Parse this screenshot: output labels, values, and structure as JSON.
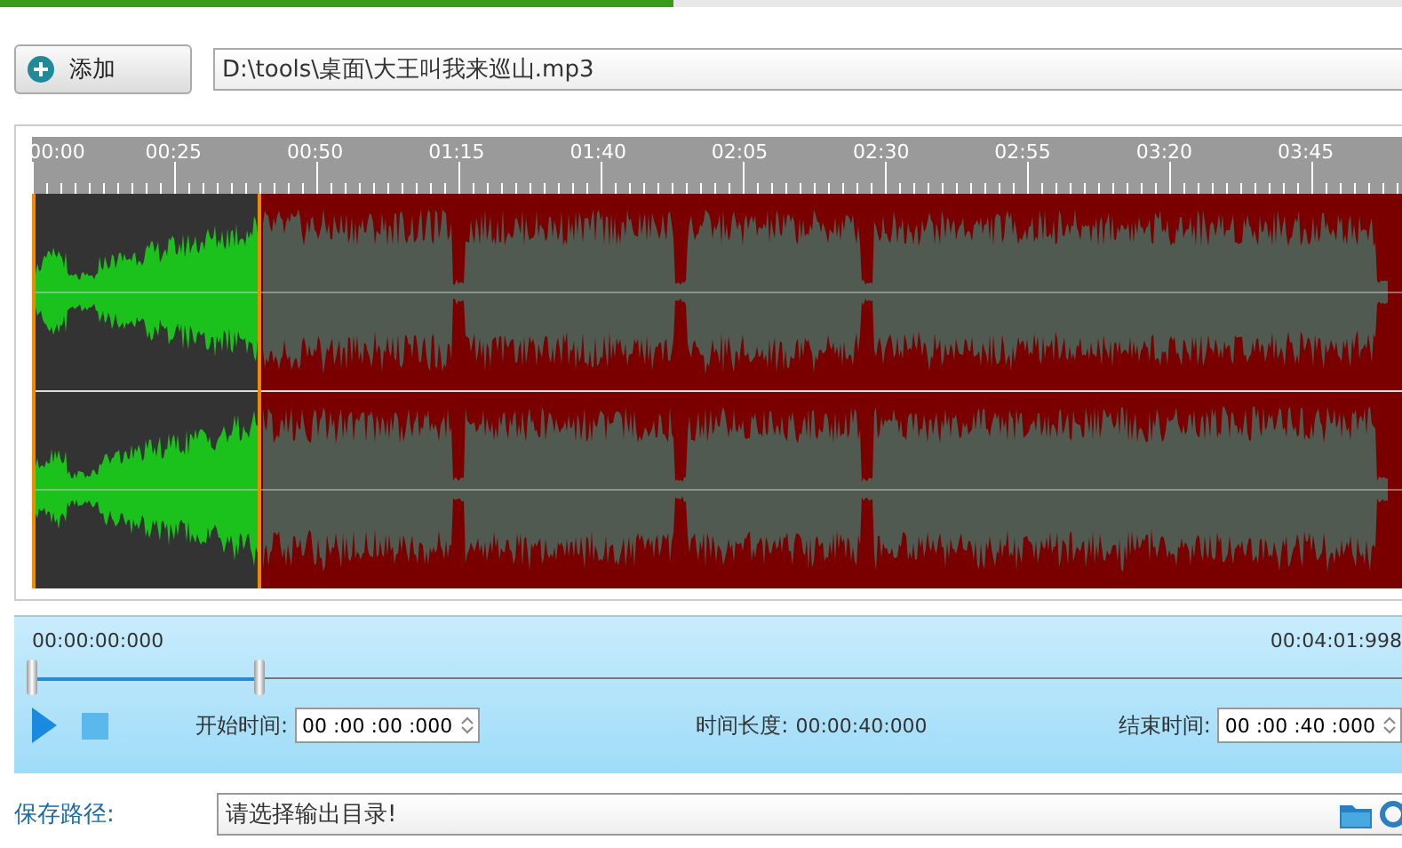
{
  "top_progress": {
    "level": 0.48
  },
  "add_button": {
    "label": "添加"
  },
  "file_path": {
    "value": "D:\\tools\\桌面\\大王叫我来巡山.mp3"
  },
  "timeline": {
    "labels": [
      "00:00",
      "00:25",
      "00:50",
      "01:15",
      "01:40",
      "02:05",
      "02:30",
      "02:55",
      "03:20",
      "03:45"
    ]
  },
  "range_slider": {
    "handles": [
      {
        "level": 0
      },
      {
        "level": 0.166
      }
    ]
  },
  "controls": {
    "start_time_total": "00:00:00:000",
    "end_time_total": "00:04:01:998",
    "start_label": "开始时间:",
    "start_value": "00 :00 :00 :000",
    "duration_label": "时间长度:",
    "duration_value": "00:00:40:000",
    "end_label": "结束时间:",
    "end_value": "00 :00 :40 :000"
  },
  "save_path": {
    "label": "保存路径:",
    "placeholder": "请选择输出目录!"
  }
}
